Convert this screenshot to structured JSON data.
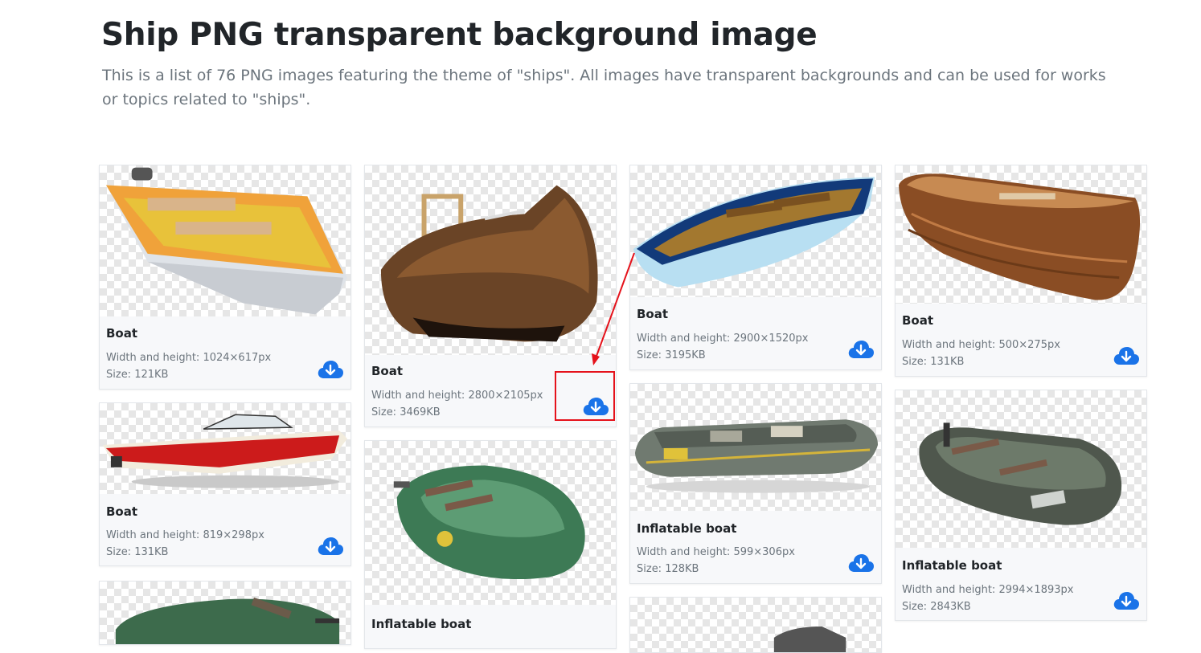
{
  "page": {
    "title": "Ship PNG transparent background image",
    "description": "This is a list of 76 PNG images featuring the theme of \"ships\". All images have transparent backgrounds and can be used for works or topics related to \"ships\"."
  },
  "colors": {
    "accent": "#1a73e8",
    "highlight": "#e5121b",
    "muted": "#6c757d"
  },
  "icons": {
    "download": "cloud-download-icon"
  },
  "cards": [
    {
      "title": "Boat",
      "dimensions": "Width and height: 1024×617px",
      "size": "Size: 121KB"
    },
    {
      "title": "Boat",
      "dimensions": "Width and height: 819×298px",
      "size": "Size: 131KB"
    },
    {
      "title": "Boat",
      "dimensions": "Width and height: 2800×2105px",
      "size": "Size: 3469KB"
    },
    {
      "title": "Inflatable boat"
    },
    {
      "title": "Boat",
      "dimensions": "Width and height: 2900×1520px",
      "size": "Size: 3195KB"
    },
    {
      "title": "Inflatable boat",
      "dimensions": "Width and height: 599×306px",
      "size": "Size: 128KB"
    },
    {
      "title": "Boat",
      "dimensions": "Width and height: 500×275px",
      "size": "Size: 131KB"
    },
    {
      "title": "Inflatable boat",
      "dimensions": "Width and height: 2994×1893px",
      "size": "Size: 2843KB"
    }
  ]
}
